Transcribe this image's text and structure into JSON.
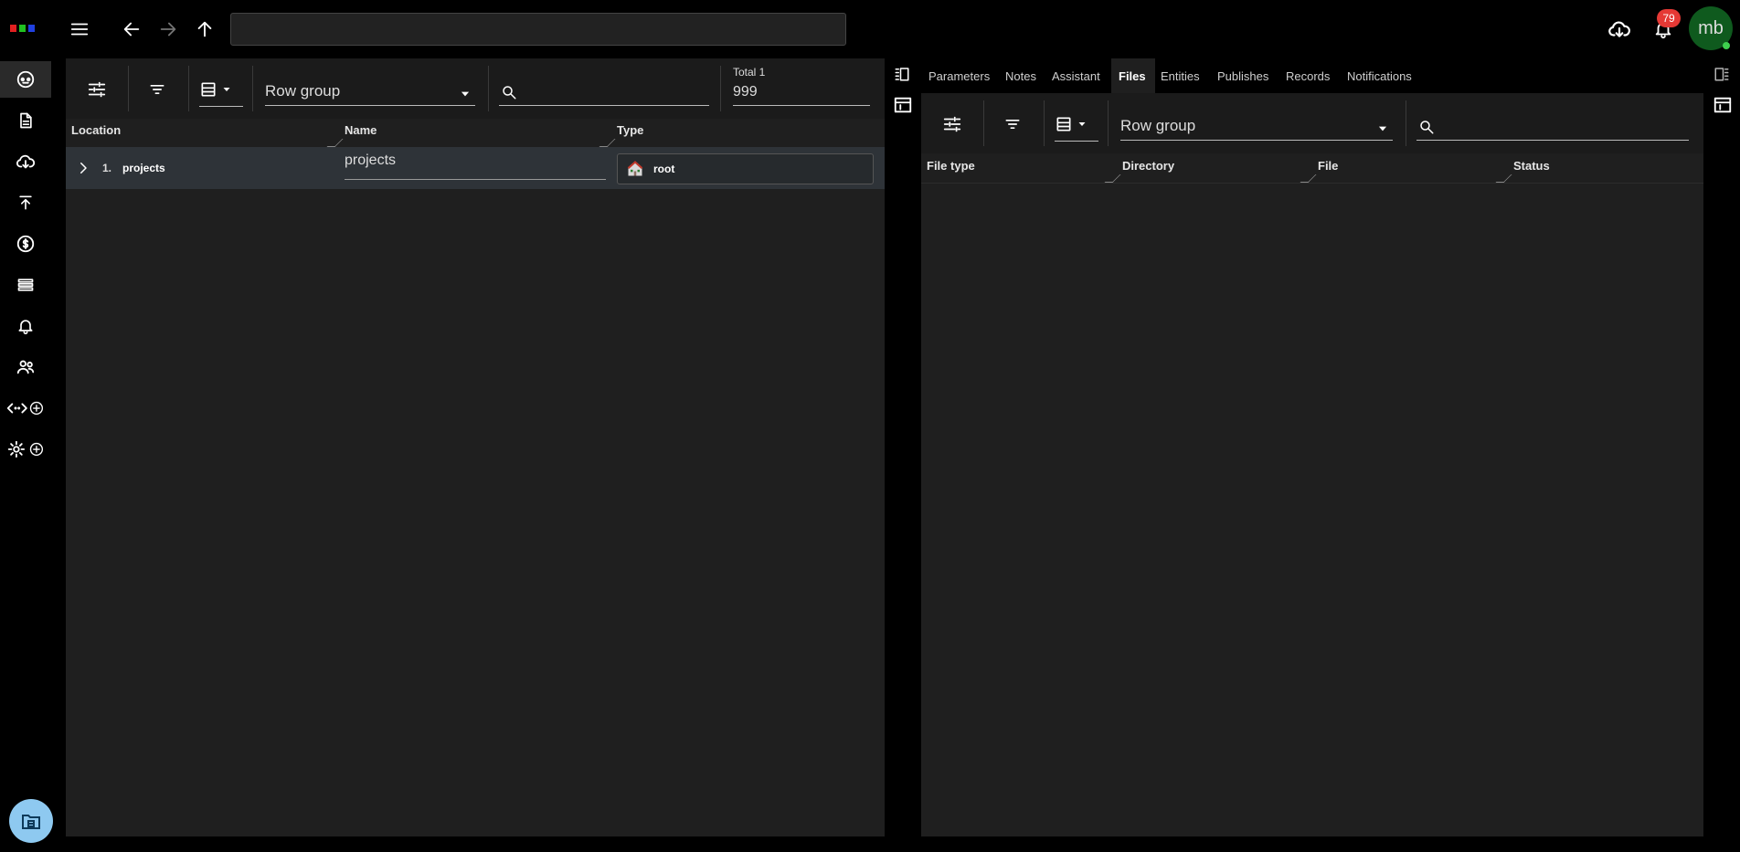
{
  "app": {
    "logo_colors": [
      "#e02020",
      "#20c020",
      "#2040e0"
    ]
  },
  "topbar": {
    "address_value": "",
    "notifications_count": "79",
    "avatar_initials": "mb"
  },
  "sidebar": {
    "items": [
      {
        "icon": "dashboard-icon"
      },
      {
        "icon": "document-icon"
      },
      {
        "icon": "cloud-download-icon"
      },
      {
        "icon": "publish-icon"
      },
      {
        "icon": "dollar-icon"
      },
      {
        "icon": "storage-icon"
      },
      {
        "icon": "bell-icon"
      },
      {
        "icon": "people-icon"
      },
      {
        "icon": "code-add-icon"
      },
      {
        "icon": "settings-add-icon"
      }
    ]
  },
  "left_panel": {
    "row_group_label": "Row group",
    "search_value": "",
    "total_label": "Total 1",
    "total_value": "999",
    "columns": [
      "Location",
      "Name",
      "Type"
    ],
    "rows": [
      {
        "index": "1.",
        "location": "projects",
        "name": "projects",
        "type": "root"
      }
    ]
  },
  "right_panel": {
    "tabs": [
      "Parameters",
      "Notes",
      "Assistant",
      "Files",
      "Entities",
      "Publishes",
      "Records",
      "Notifications"
    ],
    "active_tab": "Files",
    "row_group_label": "Row group",
    "search_value": "",
    "columns": [
      "File type",
      "Directory",
      "File",
      "Status"
    ]
  },
  "colors": {
    "panel_bg": "#1f1f1f",
    "row_selected_bg": "#2e3338",
    "accent_fab": "#8ec9f0",
    "badge": "#e53935",
    "avatar": "#0f5a1e"
  }
}
